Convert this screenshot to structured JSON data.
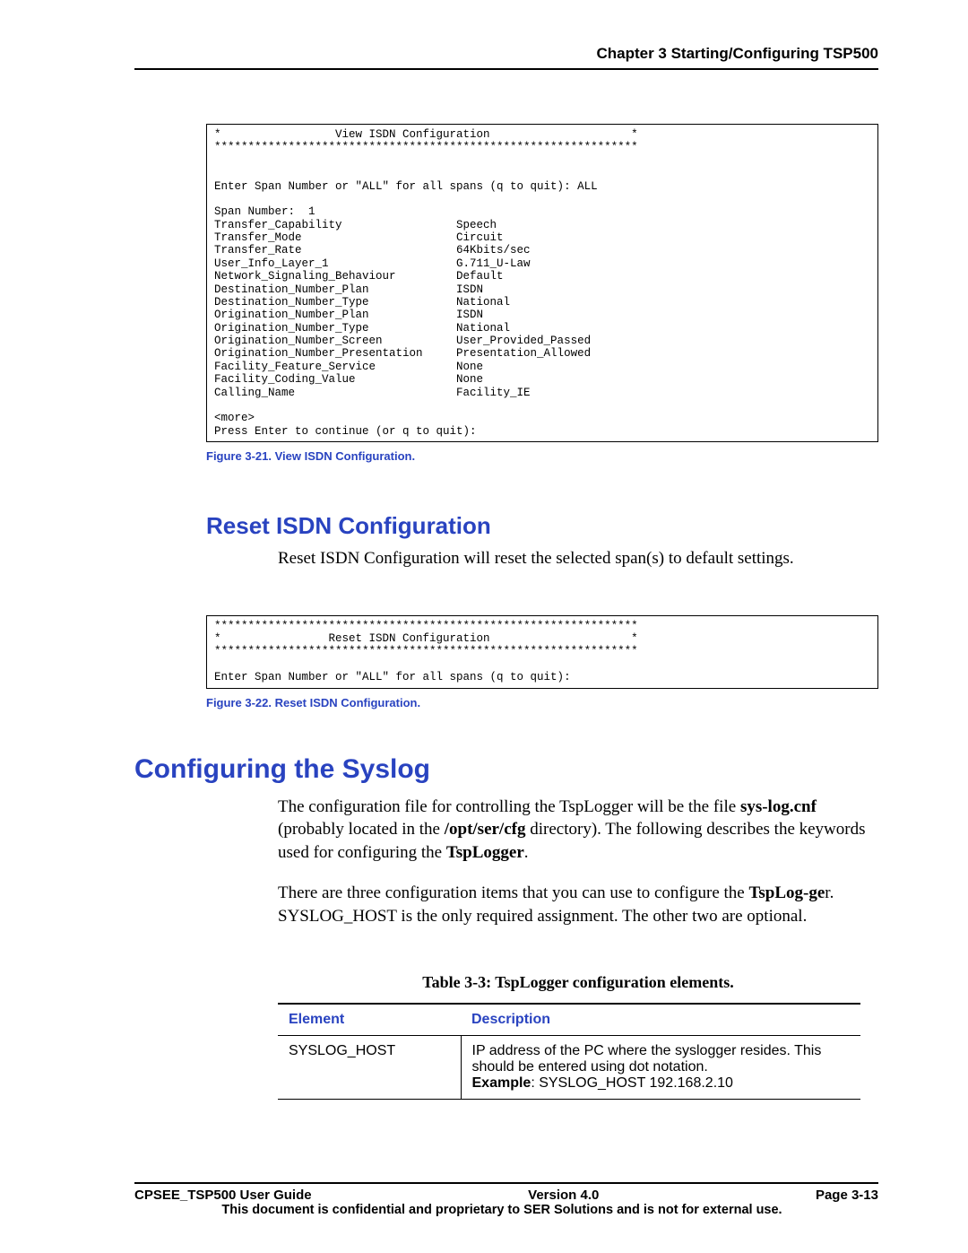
{
  "header": {
    "chapter": "Chapter 3 Starting/Configuring TSP500"
  },
  "codebox1": "*                 View ISDN Configuration                     *\n***************************************************************\n\n\nEnter Span Number or \"ALL\" for all spans (q to quit): ALL\n\nSpan Number:  1\nTransfer_Capability                 Speech\nTransfer_Mode                       Circuit\nTransfer_Rate                       64Kbits/sec\nUser_Info_Layer_1                   G.711_U-Law\nNetwork_Signaling_Behaviour         Default\nDestination_Number_Plan             ISDN\nDestination_Number_Type             National\nOrigination_Number_Plan             ISDN\nOrigination_Number_Type             National\nOrigination_Number_Screen           User_Provided_Passed\nOrigination_Number_Presentation     Presentation_Allowed\nFacility_Feature_Service            None\nFacility_Coding_Value               None\nCalling_Name                        Facility_IE\n\n<more>\nPress Enter to continue (or q to quit):",
  "fig21_caption": "Figure 3-21. View ISDN Configuration.",
  "h2_reset": "Reset ISDN Configuration",
  "reset_body": "Reset ISDN Configuration will reset the selected span(s) to default settings.",
  "codebox2": "***************************************************************\n*                Reset ISDN Configuration                     *\n***************************************************************\n\nEnter Span Number or \"ALL\" for all spans (q to quit):",
  "fig22_caption": "Figure 3-22. Reset ISDN Configuration.",
  "h1_syslog": "Configuring the Syslog",
  "syslog_para1_a": "The configuration file for controlling the TspLogger will be the file ",
  "syslog_para1_b": "sys-log.cnf",
  "syslog_para1_c": " (probably located in the ",
  "syslog_para1_d": "/opt/ser/cfg",
  "syslog_para1_e": " directory).  The following describes the keywords used for configuring the ",
  "syslog_para1_f": "TspLogger",
  "syslog_para1_g": ".",
  "syslog_para2_a": "There are three configuration items that you can use to configure the ",
  "syslog_para2_b": "TspLog-ge",
  "syslog_para2_c": "r.  SYSLOG_HOST is the only required assignment. The other two are optional.",
  "table_caption": "Table 3-3: TspLogger configuration elements.",
  "table": {
    "head_element": "Element",
    "head_desc": "Description",
    "row1_el": "SYSLOG_HOST",
    "row1_desc_a": "IP address of the PC where the syslogger resides. This should be entered using dot notation.",
    "row1_desc_b_label": "Example",
    "row1_desc_b_val": ": SYSLOG_HOST 192.168.2.10"
  },
  "footer": {
    "left": "CPSEE_TSP500 User Guide",
    "center": "Version 4.0",
    "right": "Page 3-13",
    "confidential": "This document is confidential and proprietary to SER Solutions and is not for external use."
  }
}
